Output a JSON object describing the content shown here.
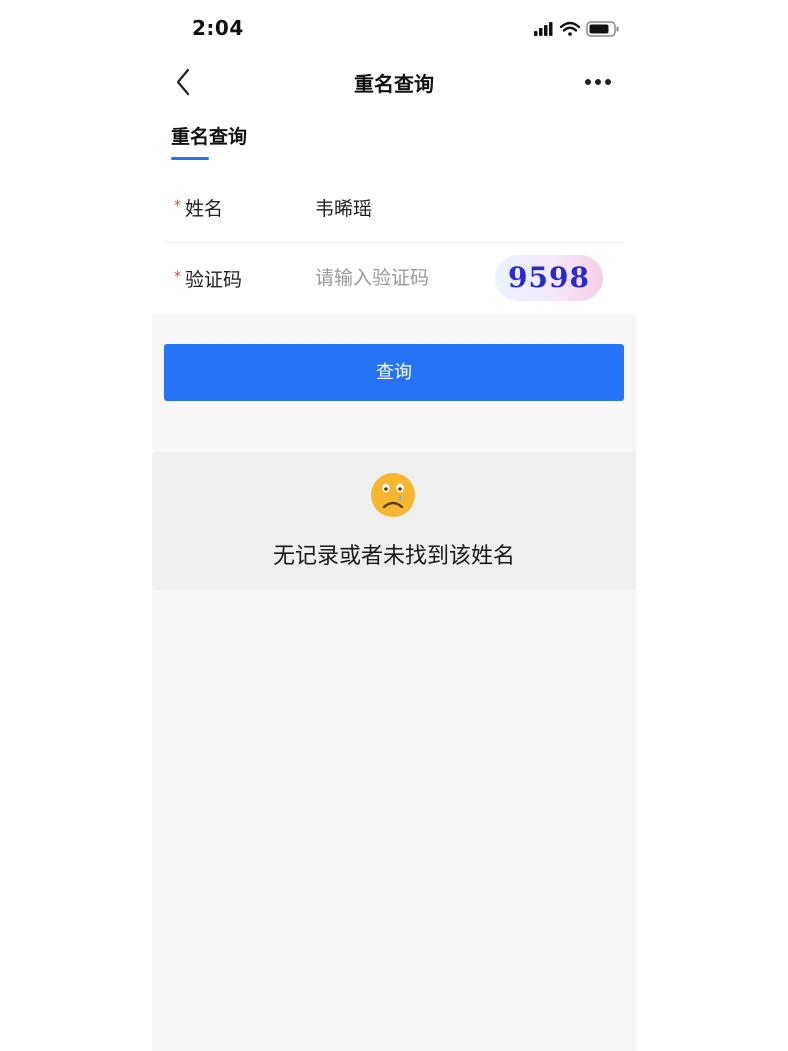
{
  "status_bar": {
    "time": "2:04"
  },
  "nav": {
    "title": "重名查询",
    "back_icon": "chevron-left-icon",
    "more_icon": "more-horizontal-icon"
  },
  "tab": {
    "label": "重名查询"
  },
  "form": {
    "name": {
      "required_mark": "*",
      "label": "姓名",
      "value": "韦晞瑶"
    },
    "captcha": {
      "required_mark": "*",
      "label": "验证码",
      "placeholder": "请输入验证码",
      "value": "",
      "image_text": "9598"
    }
  },
  "query_button": {
    "label": "查询"
  },
  "result": {
    "icon": "sad-face-icon",
    "message": "无记录或者未找到该姓名"
  },
  "colors": {
    "accent": "#2673f5",
    "required": "#e63b3b",
    "emoji": "#f5b731"
  }
}
